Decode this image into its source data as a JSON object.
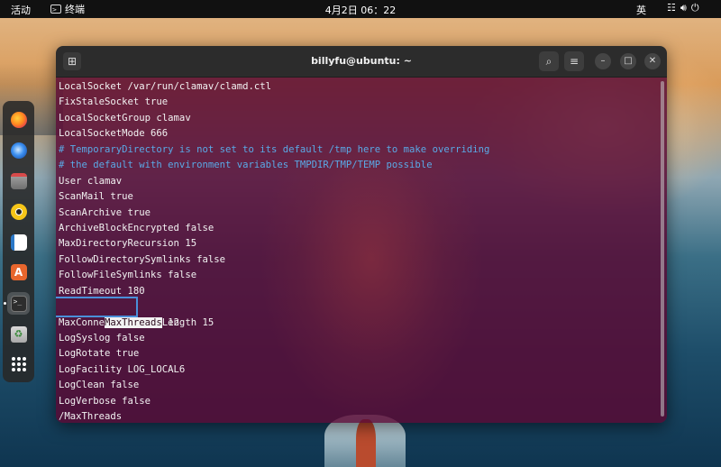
{
  "topbar": {
    "activities": "活动",
    "app_name": "终端",
    "clock": "4月2日  06：22",
    "input_method": "英",
    "status_icons": [
      "network-icon",
      "volume-icon",
      "power-icon"
    ]
  },
  "dock": {
    "items": [
      "firefox-icon",
      "thunderbird-icon",
      "files-icon",
      "rhythmbox-icon",
      "libreoffice-writer-icon",
      "ubuntu-software-icon",
      "terminal-icon",
      "trash-icon",
      "show-apps-icon"
    ],
    "active": "terminal-icon"
  },
  "terminal": {
    "title": "billyfu@ubuntu: ~",
    "header_icons": [
      "new-tab-icon",
      "search-icon",
      "menu-icon",
      "minimize-icon",
      "maximize-icon",
      "close-icon"
    ],
    "lines": [
      "LocalSocket /var/run/clamav/clamd.ctl",
      "FixStaleSocket true",
      "LocalSocketGroup clamav",
      "LocalSocketMode 666",
      "# TemporaryDirectory is not set to its default /tmp here to make overriding",
      "# the default with environment variables TMPDIR/TMP/TEMP possible",
      "User clamav",
      "ScanMail true",
      "ScanArchive true",
      "ArchiveBlockEncrypted false",
      "MaxDirectoryRecursion 15",
      "FollowDirectorySymlinks false",
      "FollowFileSymlinks false",
      "ReadTimeout 180",
      "MaxThreads",
      "MaxConnectionQueueLength 15",
      "LogSyslog false",
      "LogRotate true",
      "LogFacility LOG_LOCAL6",
      "LogClean false",
      "LogVerbose false",
      "/MaxThreads"
    ],
    "highlight_value": " 12",
    "colors": {
      "background": "#580a34",
      "comment": "#5aa9e6",
      "text": "#f2f2f2",
      "focus": "#4a90d9"
    }
  }
}
